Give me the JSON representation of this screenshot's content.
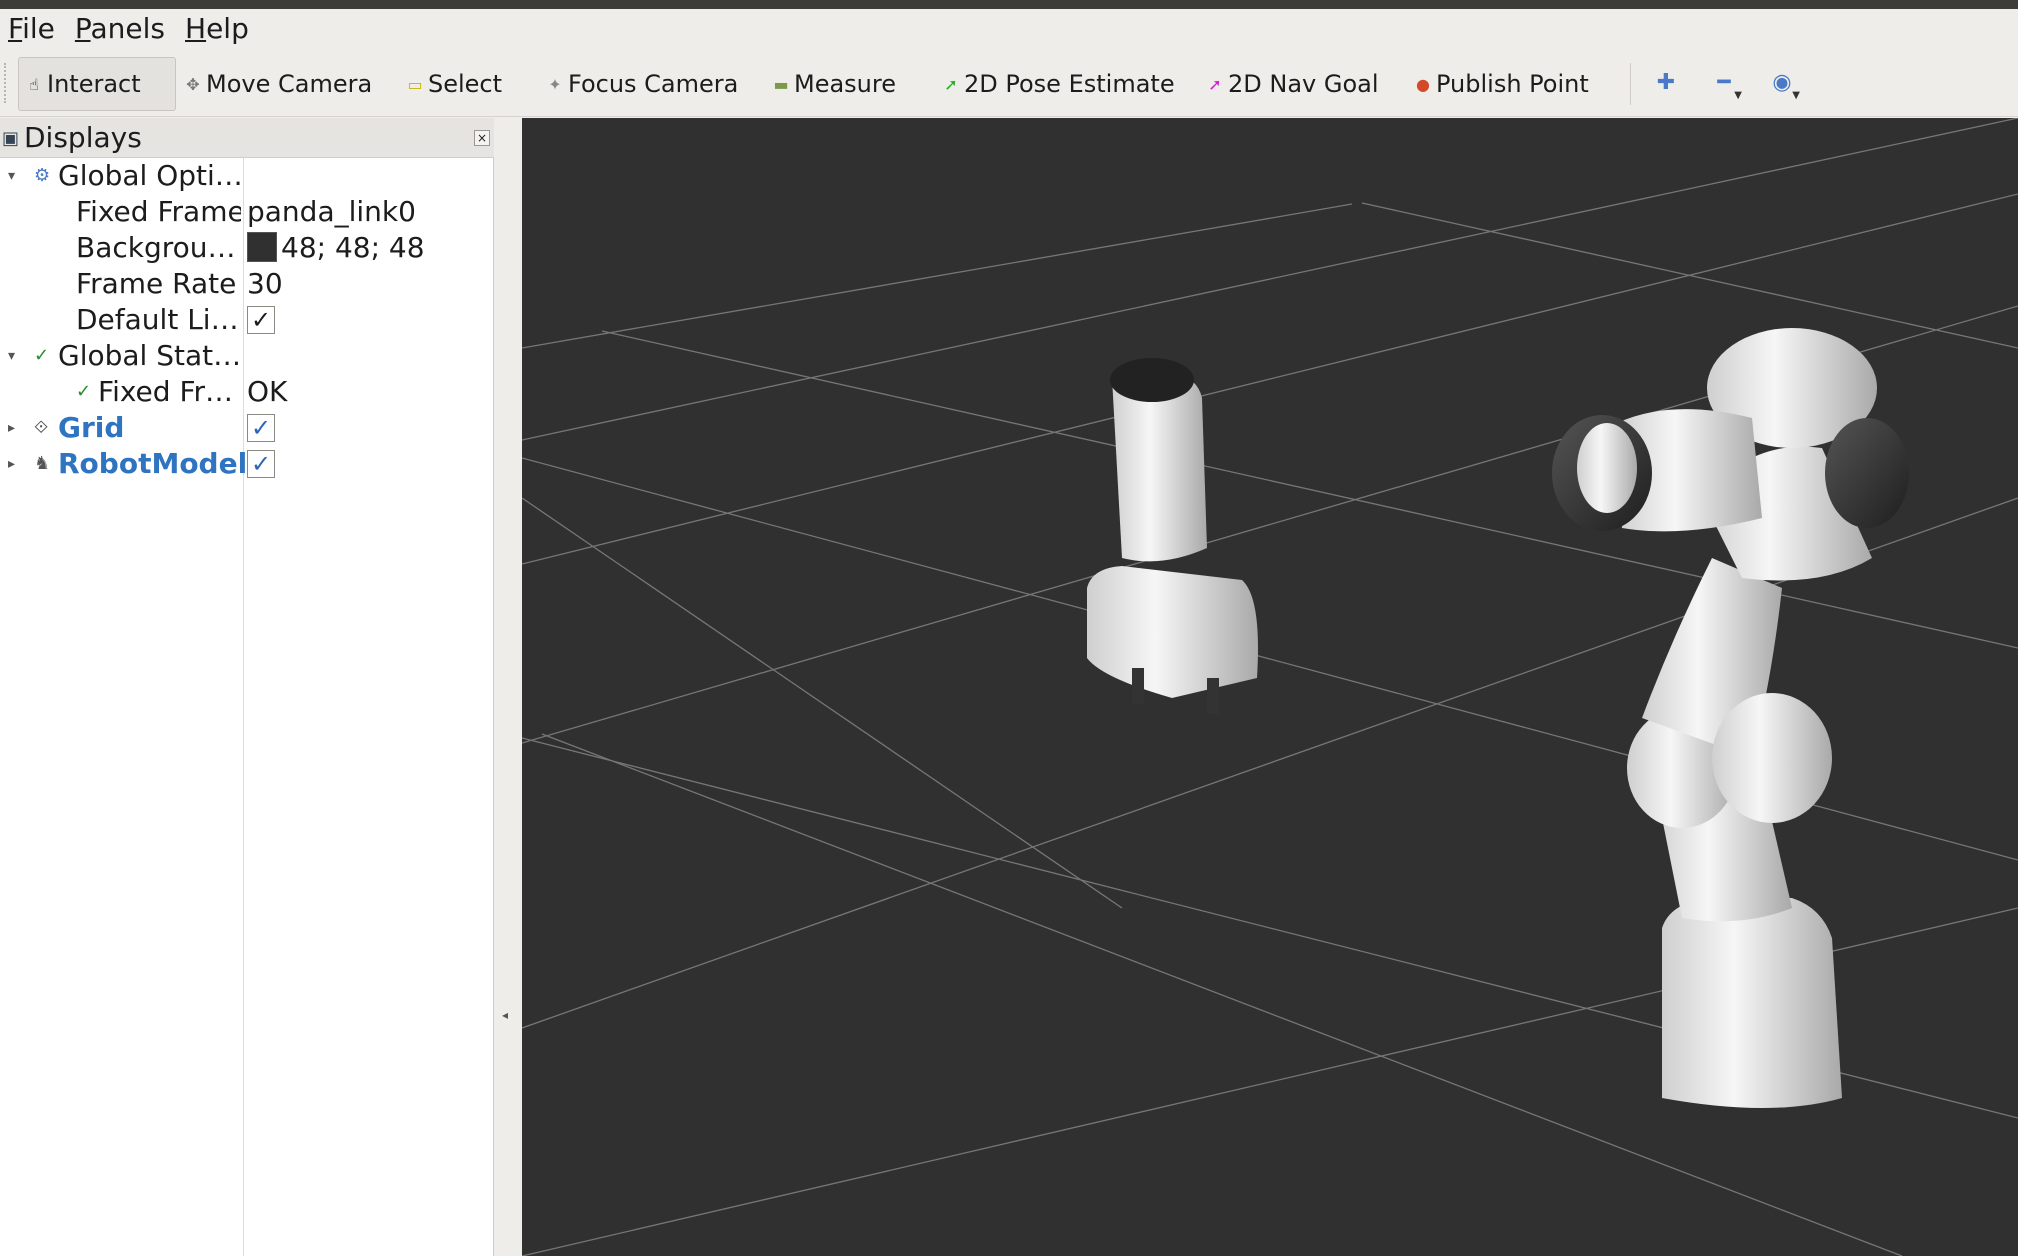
{
  "menubar": {
    "items": [
      {
        "label": "File",
        "accel": "F",
        "rest": "ile"
      },
      {
        "label": "Panels",
        "accel": "P",
        "rest": "anels"
      },
      {
        "label": "Help",
        "accel": "H",
        "rest": "elp"
      }
    ]
  },
  "toolbar": {
    "interact": "Interact",
    "move_camera": "Move Camera",
    "select": "Select",
    "focus_camera": "Focus Camera",
    "measure": "Measure",
    "pose_estimate": "2D Pose Estimate",
    "nav_goal": "2D Nav Goal",
    "publish_point": "Publish Point"
  },
  "displays": {
    "title": "Displays",
    "rows": {
      "global_options": "Global Opti…",
      "fixed_frame": {
        "name": "Fixed Frame",
        "value": "panda_link0"
      },
      "background": {
        "name": "Backgrou…",
        "value": "48; 48; 48",
        "color": "#303030"
      },
      "frame_rate": {
        "name": "Frame Rate",
        "value": "30"
      },
      "default_light": {
        "name": "Default Li…"
      },
      "global_status": "Global Stat…",
      "fixed_frame_status": {
        "name": "Fixed Fr…",
        "value": "OK"
      },
      "grid": "Grid",
      "robot_model": "RobotModel"
    }
  },
  "colors": {
    "viewport_bg": "#303030",
    "grid_line": "#9a9a9a",
    "link_blue": "#2f74c0"
  }
}
